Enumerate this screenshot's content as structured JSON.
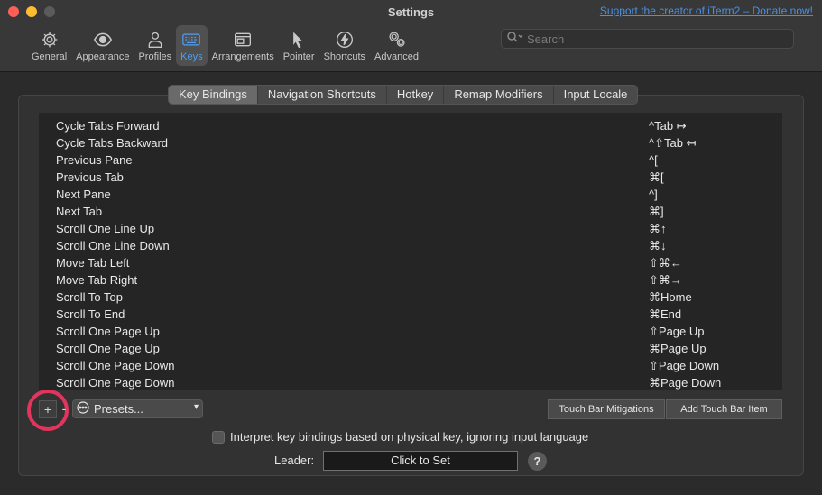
{
  "window": {
    "title": "Settings",
    "donate_link": "Support the creator of iTerm2 – Donate now!"
  },
  "toolbar": {
    "items": [
      {
        "label": "General",
        "icon": "gear-icon"
      },
      {
        "label": "Appearance",
        "icon": "eye-icon"
      },
      {
        "label": "Profiles",
        "icon": "person-icon"
      },
      {
        "label": "Keys",
        "icon": "keyboard-icon",
        "selected": true
      },
      {
        "label": "Arrangements",
        "icon": "window-icon"
      },
      {
        "label": "Pointer",
        "icon": "cursor-icon"
      },
      {
        "label": "Shortcuts",
        "icon": "bolt-icon"
      },
      {
        "label": "Advanced",
        "icon": "gears-icon"
      }
    ]
  },
  "search": {
    "placeholder": "Search"
  },
  "tabs": [
    {
      "label": "Key Bindings",
      "active": true
    },
    {
      "label": "Navigation Shortcuts"
    },
    {
      "label": "Hotkey"
    },
    {
      "label": "Remap Modifiers"
    },
    {
      "label": "Input Locale"
    }
  ],
  "bindings": [
    {
      "action": "Cycle Tabs Forward",
      "key": "^Tab ↦"
    },
    {
      "action": "Cycle Tabs Backward",
      "key": "^⇧Tab ↤"
    },
    {
      "action": "Previous Pane",
      "key": "^["
    },
    {
      "action": "Previous Tab",
      "key": "⌘["
    },
    {
      "action": "Next Pane",
      "key": "^]"
    },
    {
      "action": "Next Tab",
      "key": "⌘]"
    },
    {
      "action": "Scroll One Line Up",
      "key": "⌘↑"
    },
    {
      "action": "Scroll One Line Down",
      "key": "⌘↓"
    },
    {
      "action": "Move Tab Left",
      "key": "⇧⌘←"
    },
    {
      "action": "Move Tab Right",
      "key": "⇧⌘→"
    },
    {
      "action": "Scroll To Top",
      "key": "⌘Home"
    },
    {
      "action": "Scroll To End",
      "key": "⌘End"
    },
    {
      "action": "Scroll One Page Up",
      "key": "⇧Page Up"
    },
    {
      "action": "Scroll One Page Up",
      "key": "⌘Page Up"
    },
    {
      "action": "Scroll One Page Down",
      "key": "⇧Page Down"
    },
    {
      "action": "Scroll One Page Down",
      "key": "⌘Page Down"
    }
  ],
  "controls": {
    "add_label": "+",
    "remove_label": "-",
    "presets_label": "Presets...",
    "touch_bar_mitigations": "Touch Bar Mitigations",
    "add_touch_bar_item": "Add Touch Bar Item",
    "interpret_label": "Interpret key bindings based on physical key, ignoring input language",
    "leader_label": "Leader:",
    "leader_value": "Click to Set",
    "help_label": "?"
  },
  "colors": {
    "accent": "#4a9ff5",
    "highlight_ring": "#e0355c"
  }
}
